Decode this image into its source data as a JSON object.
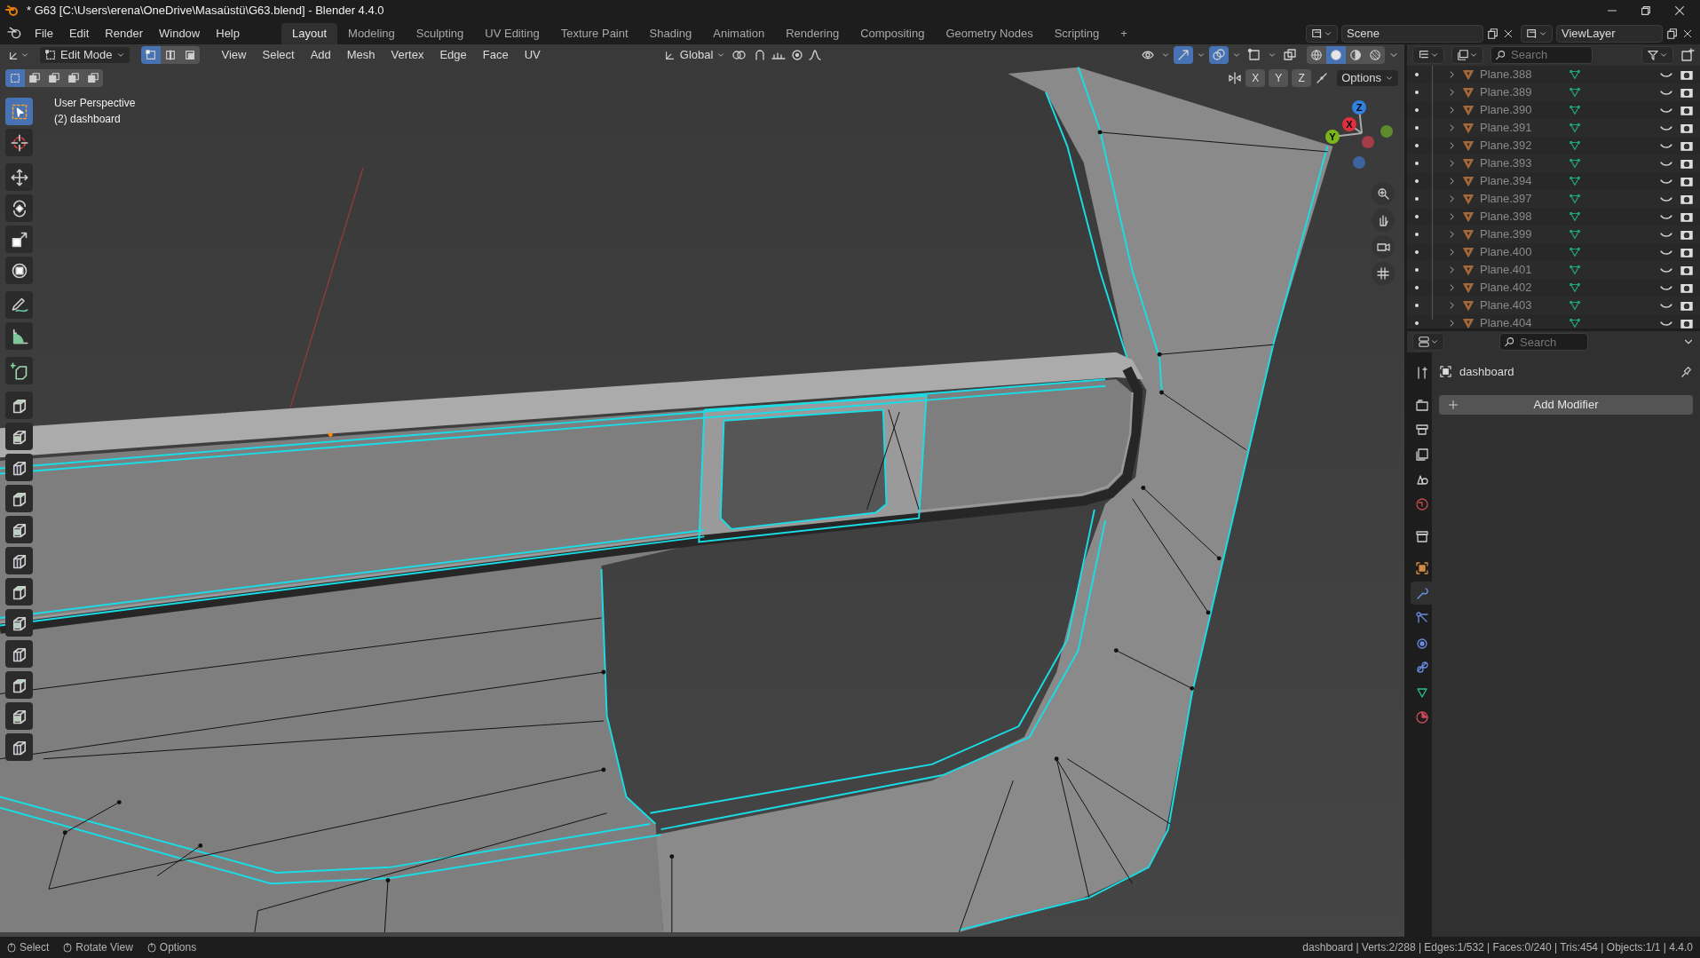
{
  "window": {
    "title": "* G63 [C:\\Users\\erena\\OneDrive\\Masaüstü\\G63.blend] - Blender 4.4.0"
  },
  "menu": [
    "File",
    "Edit",
    "Render",
    "Window",
    "Help"
  ],
  "workspaces": [
    {
      "label": "Layout",
      "selected": true
    },
    {
      "label": "Modeling",
      "selected": false
    },
    {
      "label": "Sculpting",
      "selected": false
    },
    {
      "label": "UV Editing",
      "selected": false
    },
    {
      "label": "Texture Paint",
      "selected": false
    },
    {
      "label": "Shading",
      "selected": false
    },
    {
      "label": "Animation",
      "selected": false
    },
    {
      "label": "Rendering",
      "selected": false
    },
    {
      "label": "Compositing",
      "selected": false
    },
    {
      "label": "Geometry Nodes",
      "selected": false
    },
    {
      "label": "Scripting",
      "selected": false
    }
  ],
  "add_workspace": "+",
  "scene": "Scene",
  "view_layer": "ViewLayer",
  "viewport": {
    "mode": "Edit Mode",
    "select_modes": [
      {
        "selected": true
      },
      {
        "selected": false
      },
      {
        "selected": false
      }
    ],
    "menus": [
      "View",
      "Select",
      "Add",
      "Mesh",
      "Vertex",
      "Edge",
      "Face",
      "UV"
    ],
    "orientation": "Global",
    "toggles": [
      {
        "on": false
      },
      {
        "on": true
      },
      {
        "on": true
      },
      {
        "on": false
      },
      {
        "on": false
      }
    ],
    "shading": [
      {
        "selected": false
      },
      {
        "selected": true
      },
      {
        "selected": false
      },
      {
        "selected": false
      }
    ],
    "box_modes": [
      {
        "selected": true
      },
      {
        "selected": false
      },
      {
        "selected": false
      },
      {
        "selected": false
      },
      {
        "selected": false
      }
    ],
    "axes": [
      "X",
      "Y",
      "Z"
    ],
    "options": "Options",
    "overlay_text": [
      "User Perspective",
      "(2) dashboard"
    ],
    "gizmo_labels": [
      "Z",
      "X",
      "Y"
    ]
  },
  "toolbar": [
    {
      "selected": true
    },
    {
      "selected": false
    },
    {
      "selected": false
    },
    {
      "selected": false
    },
    {
      "selected": false
    },
    {
      "selected": false
    },
    {
      "selected": false
    },
    {
      "selected": false
    },
    {
      "selected": false
    },
    {
      "selected": false
    },
    {
      "selected": false
    },
    {
      "selected": false
    },
    {
      "selected": false
    },
    {
      "selected": false
    },
    {
      "selected": false
    },
    {
      "selected": false
    },
    {
      "selected": false
    },
    {
      "selected": false
    },
    {
      "selected": false
    },
    {
      "selected": false
    },
    {
      "selected": false
    }
  ],
  "outliner": {
    "search": {
      "placeholder": "Search"
    },
    "rows": [
      {
        "name": "Plane.388",
        "hidden": true
      },
      {
        "name": "Plane.389",
        "hidden": true
      },
      {
        "name": "Plane.390",
        "hidden": true
      },
      {
        "name": "Plane.391",
        "hidden": true
      },
      {
        "name": "Plane.392",
        "hidden": true
      },
      {
        "name": "Plane.393",
        "hidden": true
      },
      {
        "name": "Plane.394",
        "hidden": true
      },
      {
        "name": "Plane.397",
        "hidden": true
      },
      {
        "name": "Plane.398",
        "hidden": true
      },
      {
        "name": "Plane.399",
        "hidden": true
      },
      {
        "name": "Plane.400",
        "hidden": true
      },
      {
        "name": "Plane.401",
        "hidden": true
      },
      {
        "name": "Plane.402",
        "hidden": true
      },
      {
        "name": "Plane.403",
        "hidden": true
      },
      {
        "name": "Plane.404",
        "hidden": true
      }
    ]
  },
  "properties": {
    "search": {
      "placeholder": "Search"
    },
    "tabs": [
      {
        "selected": false
      },
      {
        "selected": false
      },
      {
        "selected": false
      },
      {
        "selected": false
      },
      {
        "selected": false
      },
      {
        "selected": false
      },
      {
        "selected": false
      },
      {
        "selected": false
      },
      {
        "selected": true
      },
      {
        "selected": false
      },
      {
        "selected": false
      },
      {
        "selected": false
      },
      {
        "selected": false
      },
      {
        "selected": false
      }
    ],
    "object": "dashboard",
    "add_modifier": "Add Modifier"
  },
  "status_bar": {
    "items": [
      "Select",
      "Rotate View",
      "Options"
    ],
    "stats": "dashboard | Verts:2/288 | Edges:1/532 | Faces:0/240 | Tris:454 | Objects:1/1 | 4.4.0"
  }
}
